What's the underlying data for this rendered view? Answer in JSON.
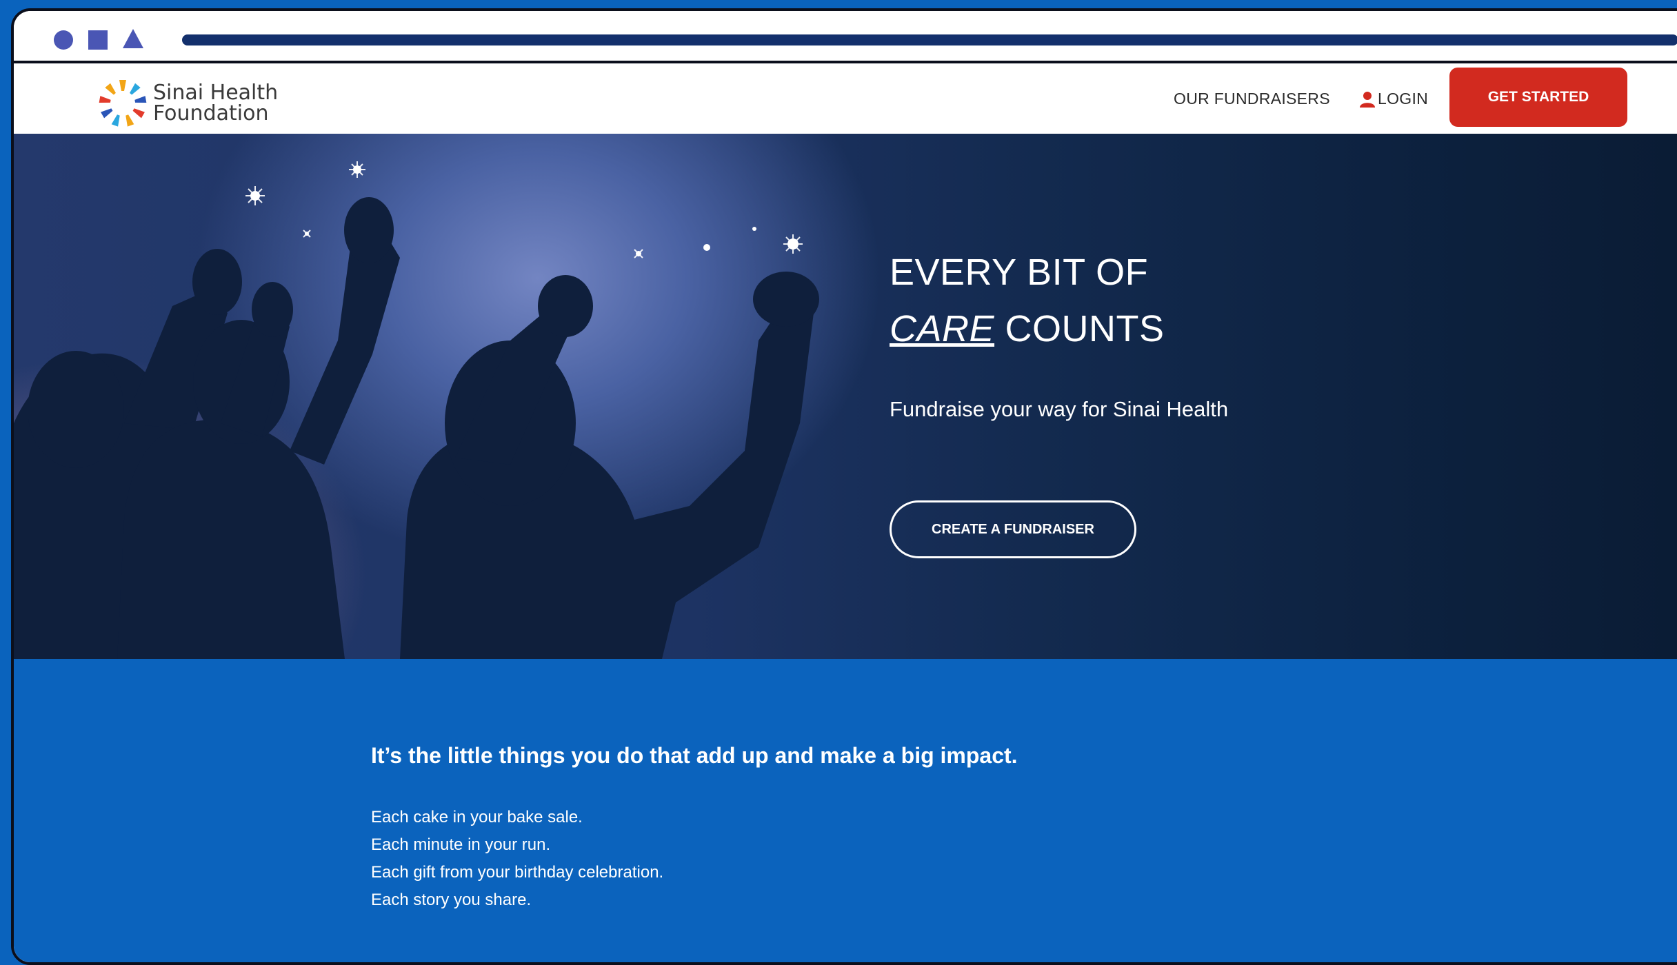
{
  "window_chrome": {
    "controls": [
      "circle-icon",
      "square-icon",
      "triangle-icon"
    ],
    "color": "#4a56b4",
    "bar_color": "#13306c"
  },
  "nav": {
    "logo": {
      "line1": "Sinai Health",
      "line2": "Foundation"
    },
    "links": {
      "fundraisers": "OUR FUNDRAISERS",
      "login": "LOGIN"
    },
    "cta": "GET STARTED",
    "cta_color": "#d22a1f"
  },
  "hero": {
    "title_line1": "EVERY BIT OF",
    "title_emphasis": "CARE",
    "title_line2_rest": " COUNTS",
    "subtitle": "Fundraise your way for Sinai Health",
    "button": "CREATE A FUNDRAISER"
  },
  "impact": {
    "heading": "It’s the little things you do that add up and make a big impact.",
    "lines": [
      "Each cake in your bake sale.",
      "Each minute in your run.",
      "Each gift from your birthday celebration.",
      "Each story you share."
    ],
    "background": "#0b63bd"
  }
}
